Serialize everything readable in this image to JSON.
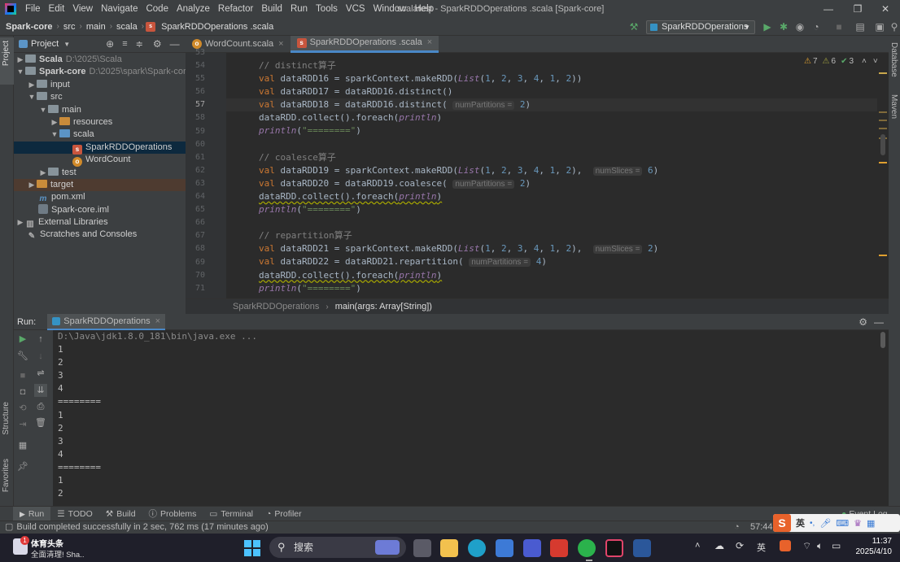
{
  "menubar": {
    "items": [
      "File",
      "Edit",
      "View",
      "Navigate",
      "Code",
      "Analyze",
      "Refactor",
      "Build",
      "Run",
      "Tools",
      "VCS",
      "Window",
      "Help"
    ],
    "window_title": "scalatest - SparkRDDOperations .scala [Spark-core]",
    "minimize": "—",
    "restore": "❐",
    "close": "✕"
  },
  "navbar": {
    "crumbs": [
      "Spark-core",
      "src",
      "main",
      "scala",
      "SparkRDDOperations .scala"
    ],
    "run_config": "SparkRDDOperations"
  },
  "project": {
    "title": "Project",
    "tree": [
      {
        "label": "Scala",
        "path": "D:\\2025\\Scala"
      },
      {
        "label": "Spark-core",
        "path": "D:\\2025\\spark\\Spark-core"
      },
      {
        "label": "input"
      },
      {
        "label": "src"
      },
      {
        "label": "main"
      },
      {
        "label": "resources"
      },
      {
        "label": "scala"
      },
      {
        "label": "SparkRDDOperations"
      },
      {
        "label": "WordCount"
      },
      {
        "label": "test"
      },
      {
        "label": "target"
      },
      {
        "label": "pom.xml"
      },
      {
        "label": "Spark-core.iml"
      },
      {
        "label": "External Libraries"
      },
      {
        "label": "Scratches and Consoles"
      }
    ]
  },
  "left_tools": {
    "project": "Project",
    "structure": "Structure",
    "favorites": "Favorites"
  },
  "right_tools": {
    "database": "Database",
    "maven": "Maven"
  },
  "tabs": [
    {
      "label": "WordCount.scala"
    },
    {
      "label": "SparkRDDOperations .scala"
    }
  ],
  "inspections": {
    "warn1": "7",
    "warn2": "6",
    "ok": "3"
  },
  "editor": {
    "line_numbers": [
      "53",
      "54",
      "55",
      "56",
      "57",
      "58",
      "59",
      "60",
      "61",
      "62",
      "63",
      "64",
      "65",
      "66",
      "67",
      "68",
      "69",
      "70",
      "71"
    ],
    "lines": [
      "// distinct算子",
      "val dataRDD16 = sparkContext.makeRDD(List(1, 2, 3, 4, 1, 2))",
      "val dataRDD17 = dataRDD16.distinct()",
      "val dataRDD18 = dataRDD16.distinct(numPartitions = 2)",
      "dataRDD.collect().foreach(println)",
      "println(\"========\")",
      "",
      "// coalesce算子",
      "val dataRDD19 = sparkContext.makeRDD(List(1, 2, 3, 4, 1, 2), numSlices = 6)",
      "val dataRDD20 = dataRDD19.coalesce(numPartitions = 2)",
      "dataRDD.collect().foreach(println)",
      "println(\"========\")",
      "",
      "// repartition算子",
      "val dataRDD21 = sparkContext.makeRDD(List(1, 2, 3, 4, 1, 2), numSlices = 2)",
      "val dataRDD22 = dataRDD21.repartition(numPartitions = 4)",
      "dataRDD.collect().foreach(println)",
      "println(\"========\")"
    ],
    "breadcrumb": [
      "SparkRDDOperations",
      "main(args: Array[String])"
    ]
  },
  "run": {
    "label": "Run:",
    "tab": "SparkRDDOperations",
    "console": [
      "D:\\Java\\jdk1.8.0_181\\bin\\java.exe ...",
      "1",
      "2",
      "3",
      "4",
      "========",
      "1",
      "2",
      "3",
      "4",
      "========",
      "1",
      "2"
    ]
  },
  "bottom_tabs": [
    "Run",
    "TODO",
    "Build",
    "Problems",
    "Terminal",
    "Profiler"
  ],
  "event_log": "Event Log",
  "status": {
    "message": "Build completed successfully in 2 sec, 762 ms (17 minutes ago)",
    "time_pos": "57:44"
  },
  "taskbar": {
    "news_title": "体育头条",
    "news_sub": "全面清理! Sha..",
    "news_badge": "1",
    "search": "搜索",
    "ime": "英",
    "time": "11:37",
    "date": "2025/4/10"
  }
}
